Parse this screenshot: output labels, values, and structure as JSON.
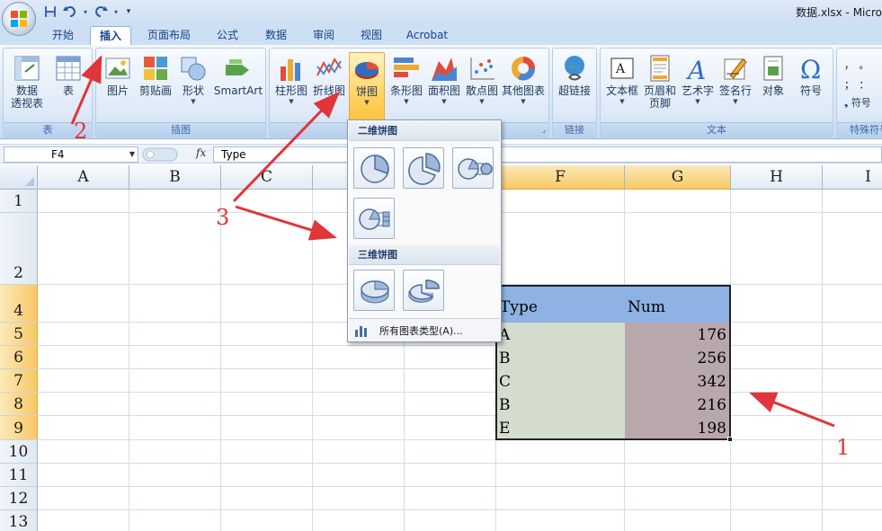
{
  "window": {
    "title": "数据.xlsx - Micro"
  },
  "quick_access": {
    "save_icon": "save-icon",
    "undo_icon": "undo-icon",
    "redo_icon": "redo-icon"
  },
  "tabs": [
    {
      "label": "开始",
      "active": false
    },
    {
      "label": "插入",
      "active": true
    },
    {
      "label": "页面布局",
      "active": false
    },
    {
      "label": "公式",
      "active": false
    },
    {
      "label": "数据",
      "active": false
    },
    {
      "label": "审阅",
      "active": false
    },
    {
      "label": "视图",
      "active": false
    },
    {
      "label": "Acrobat",
      "active": false
    }
  ],
  "ribbon": {
    "groups": [
      {
        "label": "表",
        "buttons": [
          {
            "label": "数据\n透视表"
          },
          {
            "label": "表"
          }
        ]
      },
      {
        "label": "插图",
        "buttons": [
          {
            "label": "图片"
          },
          {
            "label": "剪贴画"
          },
          {
            "label": "形状"
          },
          {
            "label": "SmartArt"
          }
        ]
      },
      {
        "label": "",
        "buttons": [
          {
            "label": "柱形图"
          },
          {
            "label": "折线图"
          },
          {
            "label": "饼图"
          },
          {
            "label": "条形图"
          },
          {
            "label": "面积图"
          },
          {
            "label": "散点图"
          },
          {
            "label": "其他图表"
          }
        ]
      },
      {
        "label": "链接",
        "buttons": [
          {
            "label": "超链接"
          }
        ]
      },
      {
        "label": "文本",
        "buttons": [
          {
            "label": "文本框"
          },
          {
            "label": "页眉和\n页脚"
          },
          {
            "label": "艺术字"
          },
          {
            "label": "签名行"
          },
          {
            "label": "对象"
          },
          {
            "label": "符号"
          }
        ]
      },
      {
        "label": "特殊符号",
        "buttons": [
          {
            "label": "符号"
          }
        ]
      }
    ]
  },
  "formula_bar": {
    "name_box": "F4",
    "fx_label": "fx",
    "content": "Type"
  },
  "columns": [
    "A",
    "B",
    "C",
    "D",
    "E",
    "F",
    "G",
    "H",
    "I"
  ],
  "rows": [
    "1",
    "2",
    "3",
    "4",
    "5",
    "6",
    "7",
    "8",
    "9",
    "10",
    "11",
    "12",
    "13"
  ],
  "table": {
    "headers": [
      "Type",
      "Num"
    ],
    "rows": [
      {
        "type": "A",
        "num": "176"
      },
      {
        "type": "B",
        "num": "256"
      },
      {
        "type": "C",
        "num": "342"
      },
      {
        "type": "B",
        "num": "216"
      },
      {
        "type": "E",
        "num": "198"
      }
    ]
  },
  "pie_menu": {
    "section_2d": "二维饼图",
    "section_3d": "三维饼图",
    "all_types": "所有图表类型(A)..."
  },
  "annotations": {
    "step1": "1",
    "step2": "2",
    "step3": "3",
    "color": "#e0353a"
  }
}
